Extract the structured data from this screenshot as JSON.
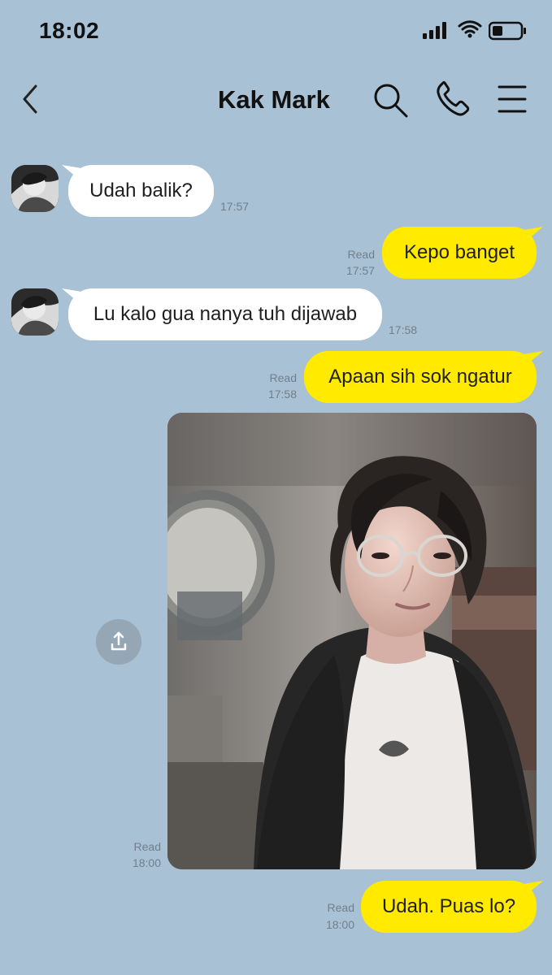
{
  "status_bar": {
    "time": "18:02",
    "icons": [
      "signal-icon",
      "wifi-icon",
      "battery-icon"
    ]
  },
  "header": {
    "title": "Kak Mark",
    "icons": [
      "back-icon",
      "search-icon",
      "phone-icon",
      "menu-icon"
    ]
  },
  "messages": [
    {
      "direction": "incoming",
      "text": "Udah balik?",
      "time": "17:57",
      "read": ""
    },
    {
      "direction": "outgoing",
      "text": "Kepo banget",
      "time": "17:57",
      "read": "Read"
    },
    {
      "direction": "incoming",
      "text": "Lu kalo gua nanya tuh dijawab",
      "time": "17:58",
      "read": ""
    },
    {
      "direction": "outgoing",
      "text": "Apaan sih sok ngatur",
      "time": "17:58",
      "read": "Read"
    },
    {
      "direction": "outgoing",
      "type": "photo",
      "time": "18:00",
      "read": "Read"
    },
    {
      "direction": "outgoing",
      "text": "Udah. Puas lo?",
      "time": "18:00",
      "read": "Read"
    }
  ],
  "colors": {
    "background": "#a9c1d4",
    "incoming_bubble": "#ffffff",
    "outgoing_bubble": "#ffea00",
    "meta_text": "#70808d",
    "share_button": "#95a7b5"
  }
}
